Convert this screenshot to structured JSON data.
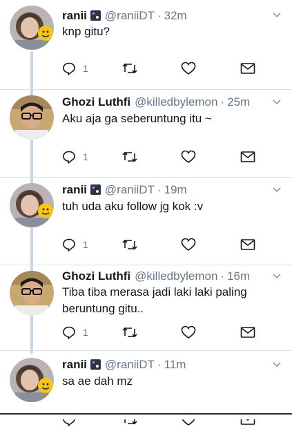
{
  "tweets": [
    {
      "name": "ranii",
      "badge": true,
      "handle": "@raniiDT",
      "time": "32m",
      "text": "knp gitu?",
      "reply_count": "1",
      "avatar": "girl"
    },
    {
      "name": "Ghozi Luthfi",
      "badge": false,
      "handle": "@killedbylemon",
      "time": "25m",
      "text": "Aku aja ga seberuntung itu ~",
      "reply_count": "1",
      "avatar": "boy"
    },
    {
      "name": "ranii",
      "badge": true,
      "handle": "@raniiDT",
      "time": "19m",
      "text": "tuh uda aku follow jg kok :v",
      "reply_count": "1",
      "avatar": "girl"
    },
    {
      "name": "Ghozi Luthfi",
      "badge": false,
      "handle": "@killedbylemon",
      "time": "16m",
      "text": "Tiba tiba merasa jadi laki laki paling beruntung gitu..",
      "reply_count": "1",
      "avatar": "boy"
    },
    {
      "name": "ranii",
      "badge": true,
      "handle": "@raniiDT",
      "time": "11m",
      "text": "sa ae dah mz",
      "reply_count": "",
      "avatar": "girl"
    }
  ],
  "separator": "·",
  "icons": {
    "reply": "reply-icon",
    "retweet": "retweet-icon",
    "like": "heart-icon",
    "dm": "envelope-icon",
    "more": "chevron-down-icon"
  },
  "colors": {
    "text": "#14171a",
    "secondary": "#657786",
    "thread_line": "#c9d6df",
    "divider": "#d8e0e6"
  }
}
